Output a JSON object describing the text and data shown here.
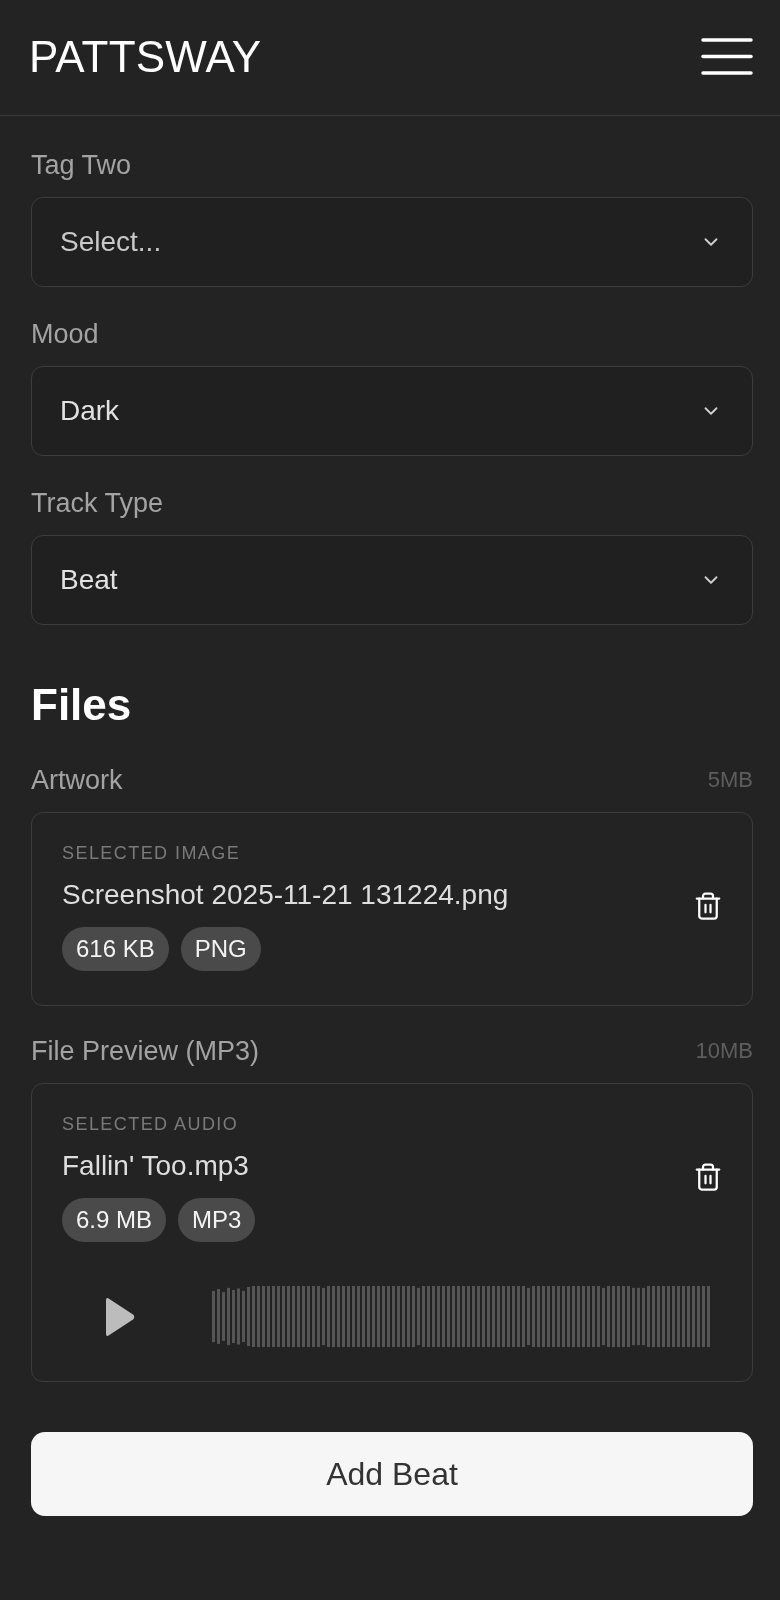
{
  "header": {
    "logo": "PATTSWAY"
  },
  "fields": [
    {
      "label": "Tag Two",
      "placeholder": "Select..."
    },
    {
      "label": "Mood",
      "value": "Dark"
    },
    {
      "label": "Track Type",
      "value": "Beat"
    }
  ],
  "files": {
    "title": "Files",
    "uploads": [
      {
        "kind": "image",
        "label": "Artwork",
        "limit": "5MB",
        "caption": "SELECTED IMAGE",
        "file_name": "Screenshot 2025-11-21 131224.png",
        "badges": [
          "616 KB",
          "PNG"
        ]
      },
      {
        "kind": "audio",
        "label": "File Preview (MP3)",
        "limit": "10MB",
        "caption": "SELECTED AUDIO",
        "file_name": "Fallin' Too.mp3",
        "badges": [
          "6.9 MB",
          "MP3"
        ]
      }
    ]
  },
  "submit_button": {
    "label": "Add Beat"
  }
}
